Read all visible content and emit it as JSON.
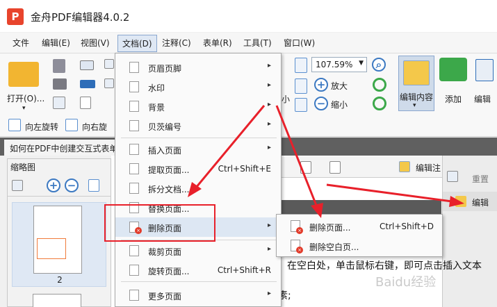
{
  "app": {
    "logo_letter": "P",
    "title": "金舟PDF编辑器4.0.2"
  },
  "menubar": [
    {
      "label": "文件"
    },
    {
      "label": "编辑(E)"
    },
    {
      "label": "视图(V)"
    },
    {
      "label": "文档(D)"
    },
    {
      "label": "注释(C)"
    },
    {
      "label": "表单(R)"
    },
    {
      "label": "工具(T)"
    },
    {
      "label": "窗口(W)"
    }
  ],
  "ribbon": {
    "open": "打开(O)...",
    "rotate_left": "向左旋转",
    "rotate_right": "向右旋",
    "size_label": "小",
    "zoom_value": "107.59%",
    "zoom_in": "放大",
    "zoom_out": "缩小",
    "edit_content": "编辑内容",
    "add": "添加",
    "edit": "编辑"
  },
  "tab": {
    "doc_title": "如何在PDF中创建交互式表单"
  },
  "thumbnails": {
    "header": "缩略图",
    "page_number": "2"
  },
  "document_menu": {
    "items": [
      {
        "label": "页眉页脚",
        "shortcut": "",
        "arrow": "▸"
      },
      {
        "label": "水印",
        "shortcut": "",
        "arrow": "▸"
      },
      {
        "label": "背景",
        "shortcut": "",
        "arrow": "▸"
      },
      {
        "label": "贝茨编号",
        "shortcut": "",
        "arrow": "▸"
      },
      {
        "label": "插入页面",
        "shortcut": "",
        "arrow": "▸"
      },
      {
        "label": "提取页面...",
        "shortcut": "Ctrl+Shift+E",
        "arrow": ""
      },
      {
        "label": "拆分文档...",
        "shortcut": "",
        "arrow": ""
      },
      {
        "label": "替换页面...",
        "shortcut": "",
        "arrow": ""
      },
      {
        "label": "删除页面",
        "shortcut": "",
        "arrow": "▸"
      },
      {
        "label": "裁剪页面",
        "shortcut": "",
        "arrow": "▸"
      },
      {
        "label": "旋转页面...",
        "shortcut": "Ctrl+Shift+R",
        "arrow": ""
      },
      {
        "label": "更多页面",
        "shortcut": "",
        "arrow": "▸"
      }
    ]
  },
  "delete_submenu": {
    "items": [
      {
        "label": "删除页面...",
        "shortcut": "Ctrl+Shift+D"
      },
      {
        "label": "删除空白页..."
      }
    ]
  },
  "content": {
    "line1": "在空白处，单击鼠标右键，即可点击插入文本",
    "line2": "素;",
    "right_panel_label": "编辑注",
    "side_item1": "重置",
    "side_item2": "编辑"
  },
  "watermark": "Baidu经验",
  "colors": {
    "accent": "#3c79c2",
    "annotation_red": "#e8202a",
    "menu_highlight": "#dde7f3"
  }
}
